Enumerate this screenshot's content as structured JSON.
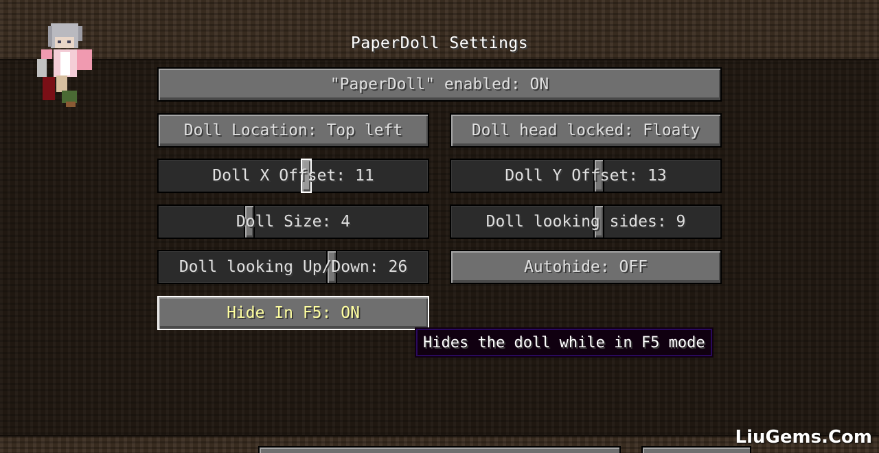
{
  "screen": {
    "title": "PaperDoll Settings"
  },
  "buttons": {
    "enabled": "\"PaperDoll\" enabled: ON",
    "location": "Doll Location: Top left",
    "head_locked": "Doll head locked: Floaty",
    "autohide": "Autohide: OFF",
    "hide_f5": "Hide In F5: ON"
  },
  "sliders": {
    "x_offset": {
      "label": "Doll X Offset: 11",
      "value": 11,
      "fraction": 0.55
    },
    "y_offset": {
      "label": "Doll Y Offset: 13",
      "value": 13,
      "fraction": 0.55
    },
    "size": {
      "label": "Doll Size: 4",
      "value": 4,
      "fraction": 0.33
    },
    "looking_sides": {
      "label": "Doll looking sides: 9",
      "value": 9,
      "fraction": 0.55
    },
    "looking_updown": {
      "label": "Doll looking Up/Down: 26",
      "value": 26,
      "fraction": 0.65
    }
  },
  "tooltip": {
    "text": "Hides the doll while in F5 mode"
  },
  "watermark": "LiuGems.Com",
  "colors": {
    "button_face": "#6f6f6f",
    "slider_track": "#2b2b2b",
    "tooltip_border": "#2a0a5e",
    "hover_border": "#ffffff"
  }
}
